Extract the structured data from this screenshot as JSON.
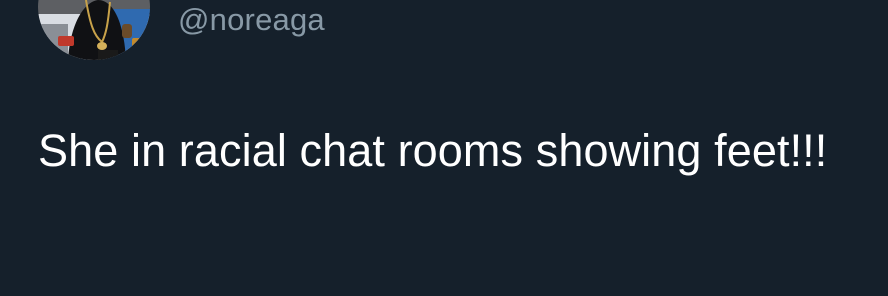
{
  "tweet": {
    "avatar_icon": "profile-avatar",
    "handle": "@noreaga",
    "text": "She in racial chat rooms showing feet!!!"
  },
  "colors": {
    "background": "#15202b",
    "handle": "#8899a6",
    "text": "#ffffff"
  }
}
